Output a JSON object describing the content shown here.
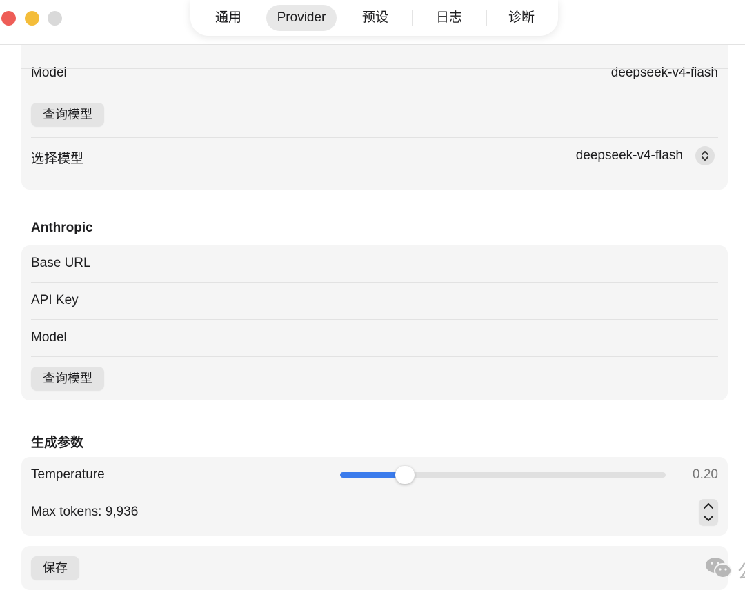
{
  "window": {
    "tabs": [
      {
        "label": "通用",
        "active": false
      },
      {
        "label": "Provider",
        "active": true
      },
      {
        "label": "预设",
        "active": false
      },
      {
        "label": "日志",
        "active": false
      },
      {
        "label": "诊断",
        "active": false
      }
    ]
  },
  "openai_card": {
    "model_label": "Model",
    "model_value": "deepseek-v4-flash",
    "query_button": "查询模型",
    "select_label": "选择模型",
    "select_value": "deepseek-v4-flash"
  },
  "anthropic": {
    "title": "Anthropic",
    "base_url_label": "Base URL",
    "api_key_label": "API Key",
    "model_label": "Model",
    "query_button": "查询模型"
  },
  "generation": {
    "title": "生成参数",
    "temperature_label": "Temperature",
    "temperature_value": "0.20",
    "temperature_fraction": 0.2,
    "max_tokens_label": "Max tokens: 9,936"
  },
  "footer": {
    "save_button": "保存",
    "watermark": "公众号 · AI Humanist by杉森楠"
  },
  "icons": {
    "popup": "chevron-up-down-icon",
    "stepper_up": "chevron-up-icon",
    "stepper_down": "chevron-down-icon",
    "watermark": "wechat-icon"
  },
  "colors": {
    "accent": "#3a7bec",
    "close": "#ee5d57",
    "minimize": "#f4bd3a",
    "maximize": "#d9d9d9"
  }
}
